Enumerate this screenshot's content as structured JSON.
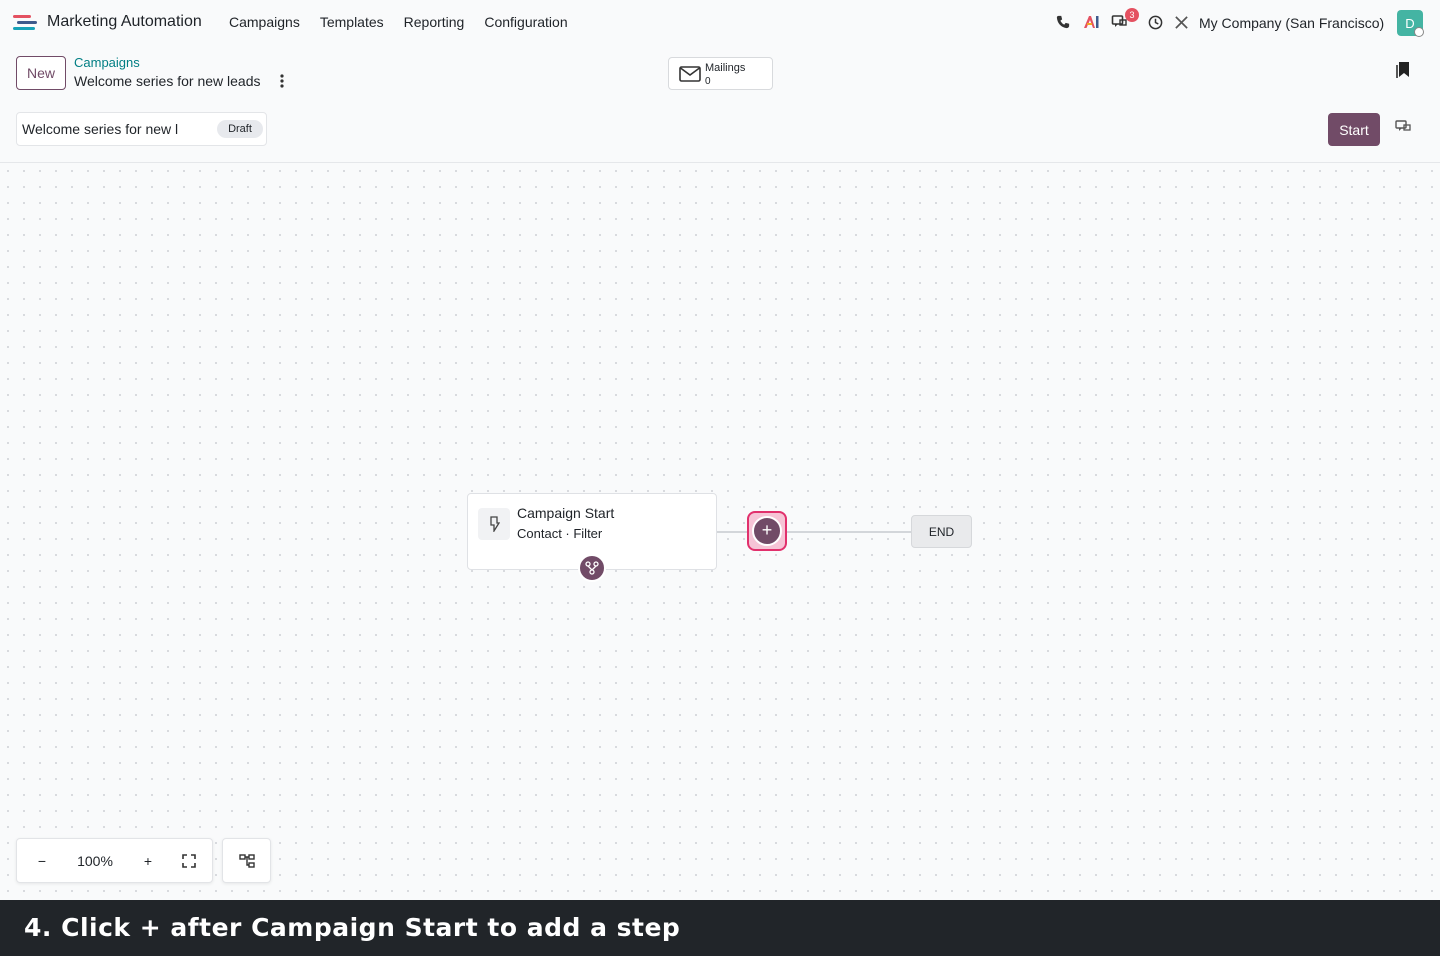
{
  "navbar": {
    "app_name": "Marketing Automation",
    "menu": [
      "Campaigns",
      "Templates",
      "Reporting",
      "Configuration"
    ],
    "messages_badge": "3",
    "company": "My Company (San Francisco)",
    "avatar_initial": "D",
    "icons": [
      "phone-icon",
      "ai-icon",
      "messages-icon",
      "clock-icon",
      "tools-icon"
    ]
  },
  "control_panel": {
    "new_label": "New",
    "breadcrumb": "Campaigns",
    "record_title": "Welcome series for new leads",
    "mailings_label": "Mailings",
    "mailings_count": "0"
  },
  "form": {
    "name_value": "Welcome series for new l",
    "status": "Draft",
    "start_label": "Start"
  },
  "workflow": {
    "start_node_title": "Campaign Start",
    "start_node_subtitle": "Contact · Filter",
    "add_step_symbol": "+",
    "end_label": "END"
  },
  "zoom": {
    "minus": "−",
    "level": "100%",
    "plus": "+"
  },
  "caption": "4. Click + after Campaign Start to add a step",
  "colors": {
    "brand": "#714b67",
    "link": "#017e84",
    "highlight": "#e1306c",
    "badge": "#e45161",
    "avatar": "#44b4a3"
  }
}
